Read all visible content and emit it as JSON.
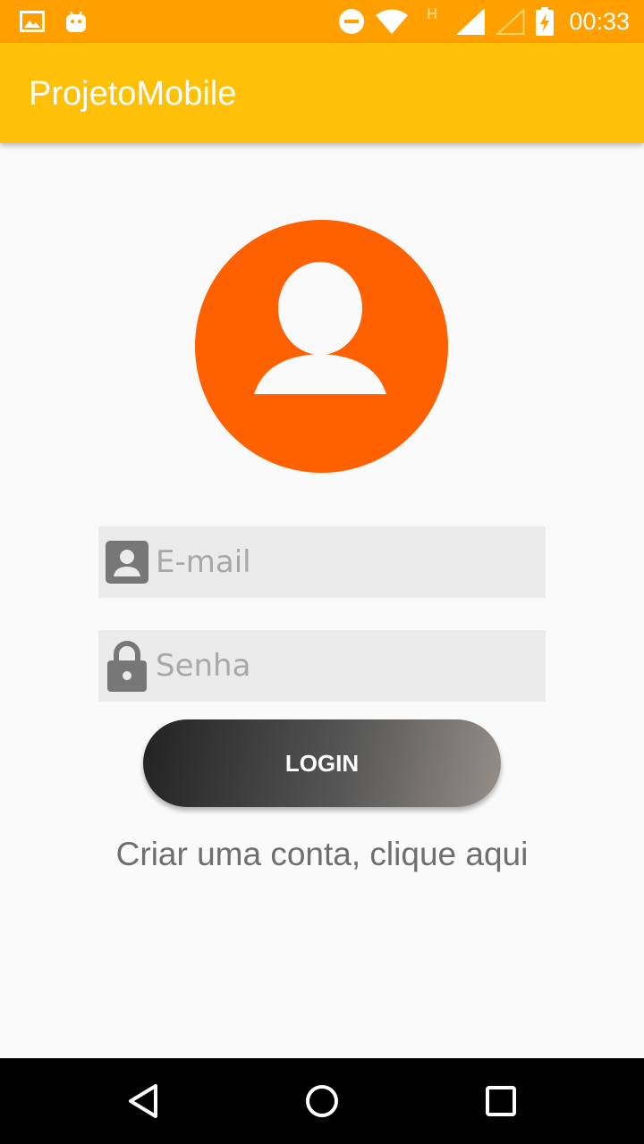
{
  "status_bar": {
    "time": "00:33",
    "icons": [
      "image-icon",
      "android-icon",
      "do-not-disturb-icon",
      "wifi-icon",
      "h-network-icon",
      "signal-icon",
      "signal-empty-icon",
      "battery-charging-icon"
    ],
    "network_label": "H"
  },
  "app_bar": {
    "title": "ProjetoMobile"
  },
  "login": {
    "avatar_icon": "person-icon",
    "email": {
      "placeholder": "E-mail",
      "value": "",
      "icon": "account-box-icon"
    },
    "password": {
      "placeholder": "Senha",
      "value": "",
      "icon": "lock-icon"
    },
    "login_button_label": "LOGIN",
    "signup_link": "Criar uma conta, clique aqui"
  },
  "nav_bar": {
    "buttons": [
      "back-icon",
      "home-icon",
      "recents-icon"
    ]
  },
  "colors": {
    "status_bar": "#ffa000",
    "app_bar": "#ffc107",
    "avatar": "#ff6100",
    "background": "#fafafa",
    "field_background": "#ebebeb"
  }
}
